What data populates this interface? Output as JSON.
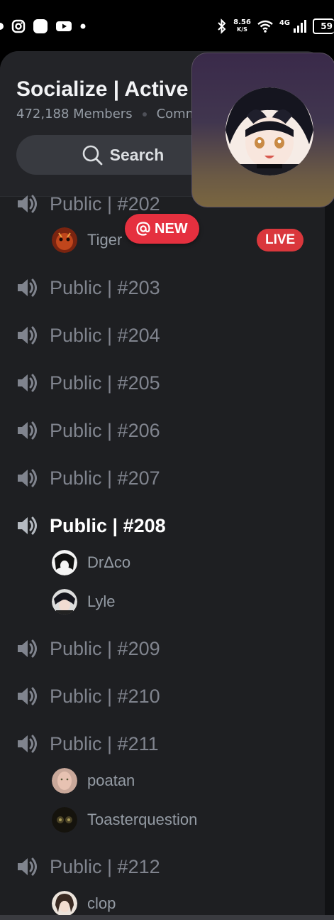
{
  "status_bar": {
    "left_icons": [
      "instagram-icon",
      "app-icon",
      "youtube-icon",
      "notification-dot-icon"
    ],
    "net_speed": "8.56",
    "net_unit": "K/S",
    "network": "4G",
    "battery": "59"
  },
  "server": {
    "name": "Socialize | Active",
    "members": "472,188 Members",
    "community": "Comm"
  },
  "search": {
    "label": "Search"
  },
  "channels": [
    {
      "name": "Public | #202",
      "users": [
        {
          "name": "Tiger"
        }
      ]
    },
    {
      "name": "Public | #203",
      "users": []
    },
    {
      "name": "Public | #204",
      "users": []
    },
    {
      "name": "Public | #205",
      "users": []
    },
    {
      "name": "Public | #206",
      "users": []
    },
    {
      "name": "Public | #207",
      "users": []
    },
    {
      "name": "Public | #208",
      "users": [
        {
          "name": "DrΔco"
        },
        {
          "name": "Lyle"
        }
      ]
    },
    {
      "name": "Public | #209",
      "users": []
    },
    {
      "name": "Public | #210",
      "users": []
    },
    {
      "name": "Public | #211",
      "users": [
        {
          "name": "poatan"
        },
        {
          "name": "Toasterquestion"
        }
      ]
    },
    {
      "name": "Public | #212",
      "users": [
        {
          "name": "clop"
        }
      ]
    }
  ],
  "badges": {
    "new": "NEW",
    "live": "LIVE"
  },
  "colors": {
    "accent_red": "#e5303f",
    "panel_bg": "#1e1f22",
    "header_bg": "#232428",
    "muted_text": "#80848e"
  }
}
